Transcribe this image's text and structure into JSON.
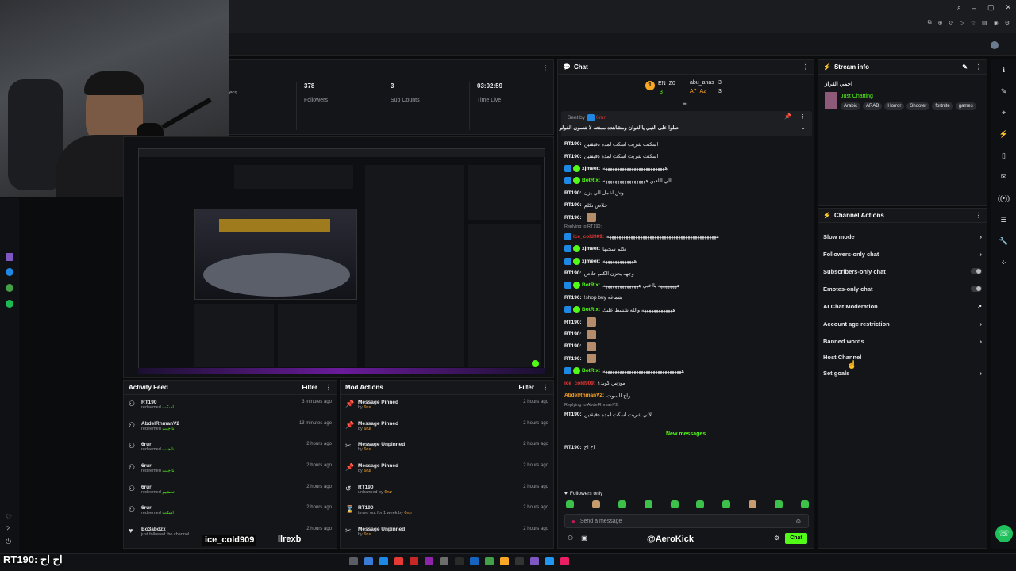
{
  "stats": [
    {
      "value": "",
      "label": "ers"
    },
    {
      "value": "378",
      "label": "Followers"
    },
    {
      "value": "3",
      "label": "Sub Counts"
    },
    {
      "value": "03:02:59",
      "label": "Time Live"
    }
  ],
  "chat": {
    "title": "Chat",
    "top_users": [
      {
        "name": "EN_Z0",
        "count": "3"
      },
      {
        "name": "abu_anas",
        "count": "3"
      },
      {
        "name": "A7_Az",
        "count": "3"
      }
    ],
    "pinned": {
      "sent_by": "Sent by",
      "sender": "6rur",
      "text": "صلوا على النبي يا لغوان ومشاهده ممتعه لا تنسون الفولو"
    },
    "messages": [
      {
        "user": "RT190:",
        "text": "اسكتت شريت اسكت لمده دقيقتين",
        "color": "#ffffff",
        "badges": 0
      },
      {
        "user": "RT190:",
        "text": "اسكتت شريت اسكت لمده دقيقتين",
        "color": "#ffffff",
        "badges": 0
      },
      {
        "user": "xjmeer:",
        "text": "ههههههههههههههههههههههههههه",
        "color": "#ffffff",
        "badges": 2
      },
      {
        "user": "BotRix:",
        "text": "الي اللعبن ههههههههههههههههههه",
        "color": "#53fc18",
        "badges": 2
      },
      {
        "user": "RT190:",
        "text": "وش اعمل الي يزن",
        "color": "#ffffff",
        "badges": 0
      },
      {
        "user": "RT190:",
        "text": "خلاص نكلم",
        "color": "#ffffff",
        "badges": 0
      },
      {
        "user": "RT190:",
        "text": "",
        "color": "#ffffff",
        "badges": 0
      },
      {
        "user": "ice_cold909:",
        "text": "ههههههههههههههههههههههههههههههههههههههههههههههه",
        "color": "#e53935",
        "badges": 1
      },
      {
        "user": "xjmeer:",
        "text": "نكلم سحبها",
        "color": "#ffffff",
        "badges": 2
      },
      {
        "user": "xjmeer:",
        "text": "هههههههههههههه",
        "color": "#ffffff",
        "badges": 2
      },
      {
        "user": "RT190:",
        "text": "وجهه يحزن الكلم خلاص",
        "color": "#ffffff",
        "badges": 0
      },
      {
        "user": "BotRix:",
        "text": "ههههههههه يااخيي هههههههههههههههه",
        "color": "#53fc18",
        "badges": 2
      },
      {
        "user": "RT190:",
        "text": "!shop buy شماغه",
        "color": "#ffffff",
        "badges": 0
      },
      {
        "user": "BotRix:",
        "text": "هههههههههههههه والله شسط عليك",
        "color": "#53fc18",
        "badges": 2
      },
      {
        "user": "RT190:",
        "text": "",
        "color": "#ffffff",
        "badges": 0
      },
      {
        "user": "RT190:",
        "text": "",
        "color": "#ffffff",
        "badges": 0
      },
      {
        "user": "RT190:",
        "text": "",
        "color": "#ffffff",
        "badges": 0
      },
      {
        "user": "RT190:",
        "text": "",
        "color": "#ffffff",
        "badges": 0
      },
      {
        "user": "BotRix:",
        "text": "هههههههههههههههههههههههههههههههههه",
        "color": "#53fc18",
        "badges": 2
      },
      {
        "user": "ice_cold909:",
        "text": "موزس كويد؟",
        "color": "#e53935",
        "badges": 0
      },
      {
        "user": "AbdelRhmanV2:",
        "text": "راح السوت",
        "color": "#ffa726",
        "badges": 0
      },
      {
        "user": "RT190:",
        "text": "لاتي شريت اسكت لمده دقيقتين",
        "color": "#ffffff",
        "badges": 0
      }
    ],
    "replying_1": "Replying to RT190:",
    "replying_2": "Replying to AbdelRhmanV2:",
    "new_messages": "New messages",
    "last_msg": {
      "user": "RT190:",
      "text": "اح اح"
    },
    "followers_only": "Followers only",
    "input_placeholder": "Send a message",
    "chat_button": "Chat"
  },
  "stream_info": {
    "title": "Stream info",
    "stream_title": "احمي القراز",
    "category": "Just Chatting",
    "tags": [
      "Arabic",
      "ARAB",
      "Horror",
      "Shooter",
      "fortnite",
      "games"
    ]
  },
  "channel_actions": {
    "title": "Channel Actions",
    "items": [
      {
        "label": "Slow mode",
        "control": "chevron"
      },
      {
        "label": "Followers-only chat",
        "control": "chevron"
      },
      {
        "label": "Subscribers-only chat",
        "control": "toggle"
      },
      {
        "label": "Emotes-only chat",
        "control": "toggle"
      },
      {
        "label": "AI Chat Moderation",
        "control": "external"
      },
      {
        "label": "Account age restriction",
        "control": "chevron"
      },
      {
        "label": "Banned words",
        "control": "chevron"
      },
      {
        "label": "Host Channel",
        "control": "none"
      },
      {
        "label": "Set goals",
        "control": "chevron"
      }
    ]
  },
  "activity_feed": {
    "title": "Activity Feed",
    "filter": "Filter",
    "items": [
      {
        "user": "RT190",
        "sub": "redeemed",
        "reward": "اسكت",
        "time": "3 minutes ago"
      },
      {
        "user": "AbdelRhmanV2",
        "sub": "redeemed",
        "reward": "انا جيت",
        "time": "13 minutes ago"
      },
      {
        "user": "6rur",
        "sub": "redeemed",
        "reward": "انا جيت",
        "time": "2 hours ago"
      },
      {
        "user": "6rur",
        "sub": "redeemed",
        "reward": "انا جيت",
        "time": "2 hours ago"
      },
      {
        "user": "6rur",
        "sub": "redeemed",
        "reward": "تحشيم",
        "time": "2 hours ago"
      },
      {
        "user": "6rur",
        "sub": "redeemed",
        "reward": "اسكت",
        "time": "2 hours ago"
      },
      {
        "user": "Bo3abdzx",
        "sub": "just followed the channel",
        "reward": "",
        "time": "2 hours ago"
      }
    ]
  },
  "mod_actions": {
    "title": "Mod Actions",
    "filter": "Filter",
    "items": [
      {
        "action": "Message Pinned",
        "by": "by",
        "mod": "6rur",
        "time": "2 hours ago",
        "icon": "pin"
      },
      {
        "action": "Message Pinned",
        "by": "by",
        "mod": "6rur",
        "time": "2 hours ago",
        "icon": "pin"
      },
      {
        "action": "Message Unpinned",
        "by": "by",
        "mod": "6rur",
        "time": "2 hours ago",
        "icon": "unpin"
      },
      {
        "action": "Message Pinned",
        "by": "by",
        "mod": "6rur",
        "time": "2 hours ago",
        "icon": "pin"
      },
      {
        "action": "RT190",
        "by": "unbanned by",
        "mod": "6rur",
        "time": "2 hours ago",
        "icon": "undo"
      },
      {
        "action": "RT190",
        "by": "timed out for 1 week by",
        "mod": "6rur",
        "time": "2 hours ago",
        "icon": "hourglass"
      },
      {
        "action": "Message Unpinned",
        "by": "by",
        "mod": "6rur",
        "time": "2 hours ago",
        "icon": "unpin"
      }
    ]
  },
  "overlay": {
    "name1": "ice_cold909",
    "name2": "llrexb",
    "name3": "@AeroKick",
    "bottom_left": "RT190: اح اح"
  },
  "colors": {
    "accent": "#53fc18",
    "panel": "#141518",
    "bg": "#0b0c0e"
  }
}
